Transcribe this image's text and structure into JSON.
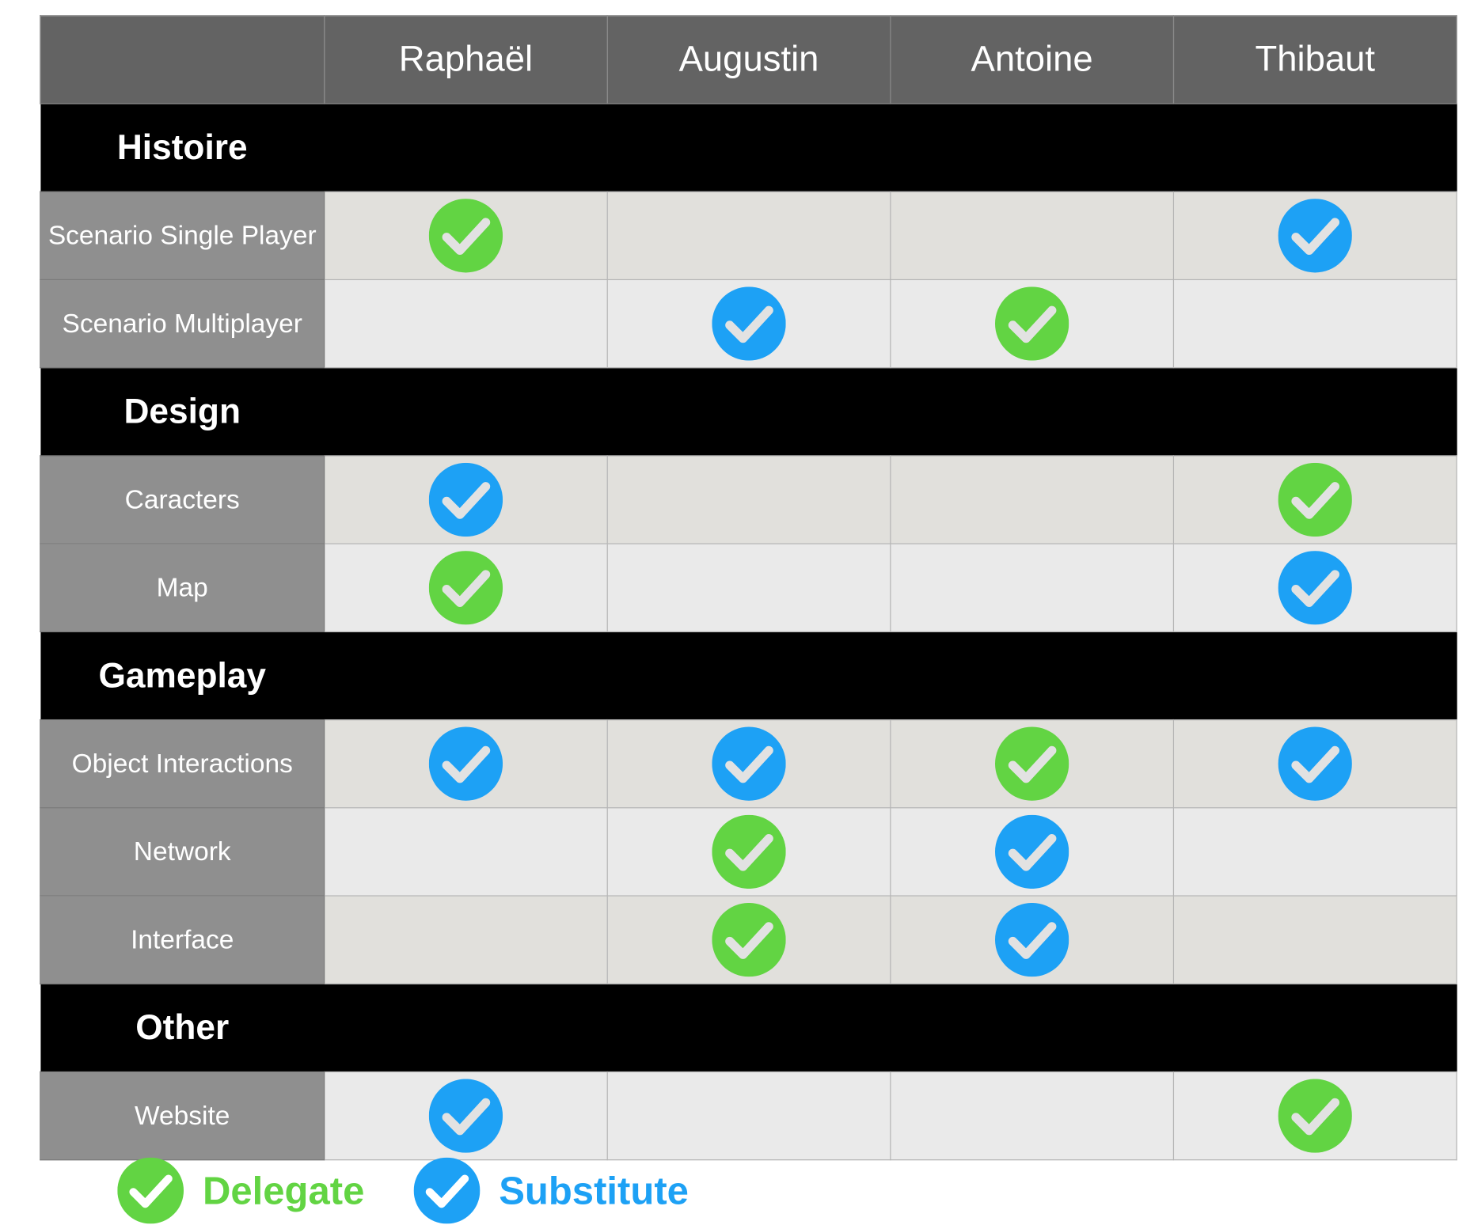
{
  "columns": [
    "Raphaël",
    "Augustin",
    "Antoine",
    "Thibaut"
  ],
  "colors": {
    "delegate": "#62d443",
    "substitute": "#1da1f5",
    "check_mark": "#e2e2e2"
  },
  "sections": [
    {
      "title": "Histoire",
      "rows": [
        {
          "label": "Scenario Single Player",
          "marks": [
            "delegate",
            "",
            "",
            "substitute"
          ]
        },
        {
          "label": "Scenario Multiplayer",
          "marks": [
            "",
            "substitute",
            "delegate",
            ""
          ]
        }
      ]
    },
    {
      "title": "Design",
      "rows": [
        {
          "label": "Caracters",
          "marks": [
            "substitute",
            "",
            "",
            "delegate"
          ]
        },
        {
          "label": "Map",
          "marks": [
            "delegate",
            "",
            "",
            "substitute"
          ]
        }
      ]
    },
    {
      "title": "Gameplay",
      "rows": [
        {
          "label": "Object Interactions",
          "marks": [
            "substitute",
            "substitute",
            "delegate",
            "substitute"
          ]
        },
        {
          "label": "Network",
          "marks": [
            "",
            "delegate",
            "substitute",
            ""
          ]
        },
        {
          "label": "Interface",
          "marks": [
            "",
            "delegate",
            "substitute",
            ""
          ]
        }
      ]
    },
    {
      "title": "Other",
      "rows": [
        {
          "label": "Website",
          "marks": [
            "substitute",
            "",
            "",
            "delegate"
          ]
        }
      ]
    }
  ],
  "legend": [
    {
      "type": "delegate",
      "label": "Delegate",
      "icon": "green-check-icon"
    },
    {
      "type": "substitute",
      "label": "Substitute",
      "icon": "blue-check-icon"
    }
  ]
}
